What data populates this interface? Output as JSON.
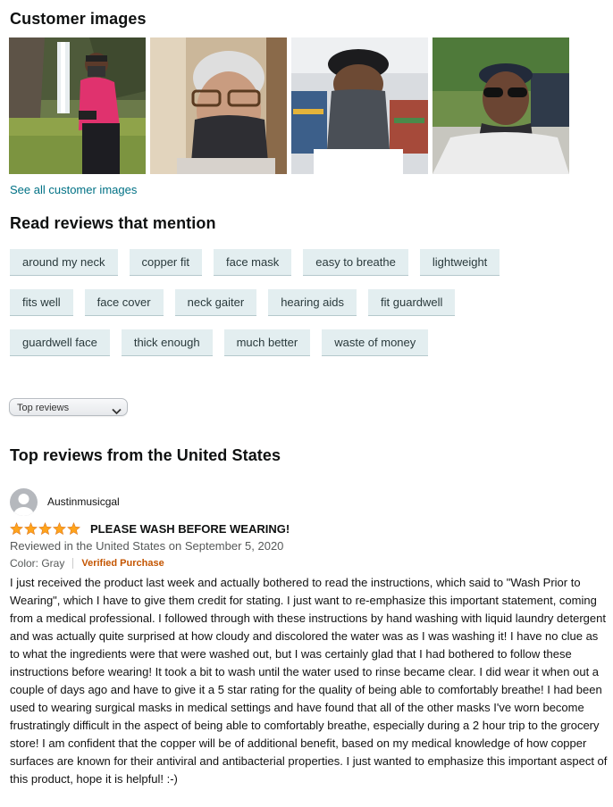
{
  "customer_images": {
    "title": "Customer images",
    "see_all": "See all customer images",
    "images": [
      {
        "name": "thumb-waterfall-woman"
      },
      {
        "name": "thumb-older-man-glasses"
      },
      {
        "name": "thumb-man-store"
      },
      {
        "name": "thumb-man-sunglasses"
      }
    ]
  },
  "mentions": {
    "title": "Read reviews that mention",
    "rows": [
      [
        "around my neck",
        "copper fit",
        "face mask",
        "easy to breathe",
        "lightweight"
      ],
      [
        "fits well",
        "face cover",
        "neck gaiter",
        "hearing aids",
        "fit guardwell"
      ],
      [
        "guardwell face",
        "thick enough",
        "much better",
        "waste of money"
      ]
    ]
  },
  "sort": {
    "selected": "Top reviews"
  },
  "top_reviews": {
    "title": "Top reviews from the United States",
    "review": {
      "author": "Austinmusicgal",
      "rating": 5,
      "title": "PLEASE WASH BEFORE WEARING!",
      "date_line": "Reviewed in the United States on September 5, 2020",
      "color": "Color: Gray",
      "verified": "Verified Purchase",
      "body": "I just received the product last week and actually bothered to read the instructions, which said to \"Wash Prior to Wearing\", which I have to give them credit for stating. I just want to re-emphasize this important statement, coming from a medical professional. I followed through with these instructions by hand washing with liquid laundry detergent and was actually quite surprised at how cloudy and discolored the water was as I was washing it! I have no clue as to what the ingredients were that were washed out, but I was certainly glad that I had bothered to follow these instructions before wearing! It took a bit to wash until the water used to rinse became clear. I did wear it when out a couple of days ago and have to give it a 5 star rating for the quality of being able to comfortably breathe! I had been used to wearing surgical masks in medical settings and have found that all of the other masks I've worn become frustratingly difficult in the aspect of being able to comfortably breathe, especially during a 2 hour trip to the grocery store! I am confident that the copper will be of additional benefit, based on my medical knowledge of how copper surfaces are known for their antiviral and antibacterial properties. I just wanted to emphasize this important aspect of this product, hope it is helpful! :-)"
    }
  },
  "colors": {
    "link": "#007185",
    "chip_bg": "#e3eef0",
    "star": "#ffa41c",
    "verified": "#c45500"
  }
}
